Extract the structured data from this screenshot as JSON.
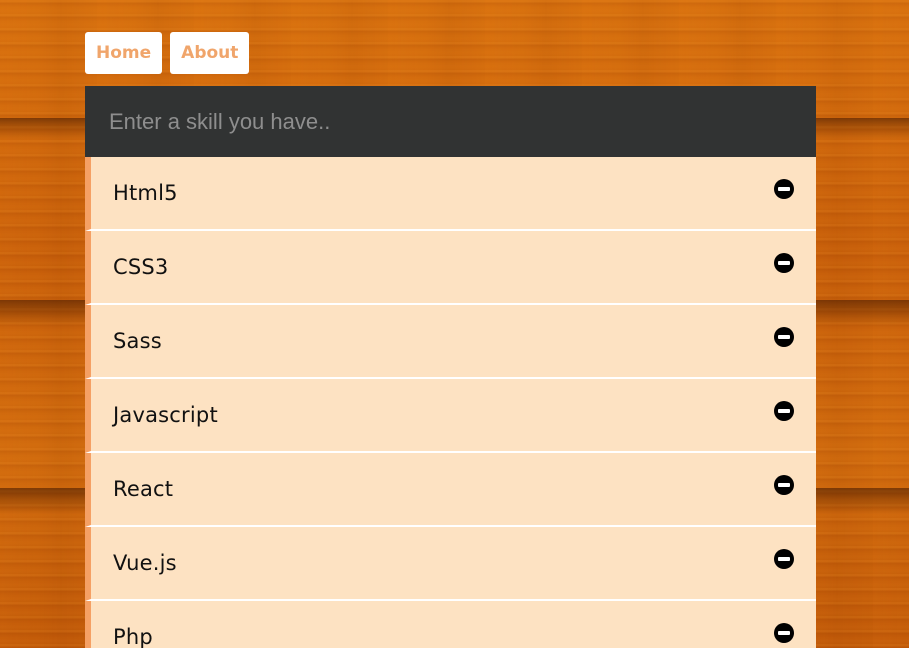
{
  "nav": {
    "items": [
      {
        "label": "Home"
      },
      {
        "label": "About"
      }
    ]
  },
  "skill_input": {
    "placeholder": "Enter a skill you have..",
    "value": ""
  },
  "skills": [
    {
      "label": "Html5",
      "icon": "remove-circle-icon"
    },
    {
      "label": "CSS3",
      "icon": "remove-circle-icon"
    },
    {
      "label": "Sass",
      "icon": "remove-circle-icon"
    },
    {
      "label": "Javascript",
      "icon": "remove-circle-icon"
    },
    {
      "label": "React",
      "icon": "remove-circle-icon"
    },
    {
      "label": "Vue.js",
      "icon": "remove-circle-icon"
    },
    {
      "label": "Php",
      "icon": "remove-circle-icon"
    }
  ],
  "colors": {
    "nav_text": "#f0a56b",
    "input_bg": "#313333",
    "item_bg": "#fde2c2",
    "item_accent": "#f5a064"
  }
}
